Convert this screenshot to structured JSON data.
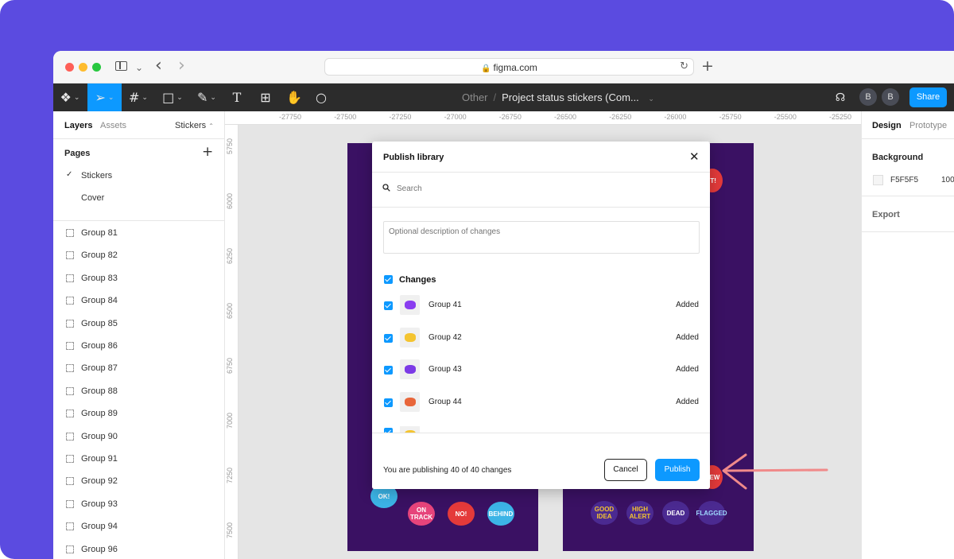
{
  "browser": {
    "url": "figma.com"
  },
  "toolbar": {
    "project": "Other",
    "file_name": "Project status stickers (Com...",
    "avatars": [
      "B",
      "B"
    ],
    "share_label": "Share"
  },
  "left_panel": {
    "tabs": [
      "Layers",
      "Assets"
    ],
    "page_selector": "Stickers",
    "pages_title": "Pages",
    "pages": [
      {
        "label": "Stickers",
        "selected": true
      },
      {
        "label": "Cover",
        "selected": false
      }
    ],
    "layers": [
      "Group 81",
      "Group 82",
      "Group 83",
      "Group 84",
      "Group 85",
      "Group 86",
      "Group 87",
      "Group 88",
      "Group 89",
      "Group 90",
      "Group 91",
      "Group 92",
      "Group 93",
      "Group 94",
      "Group 96"
    ]
  },
  "canvas": {
    "ruler_top": [
      "-27750",
      "-27500",
      "-27250",
      "-27000",
      "-26750",
      "-26500",
      "-26250",
      "-26000",
      "-25750",
      "-25500",
      "-25250"
    ],
    "ruler_left": [
      "5750",
      "6000",
      "6250",
      "6500",
      "6750",
      "7000",
      "7250",
      "7500"
    ],
    "frame_color": "#3a1163",
    "sticker_texts": [
      "OK!",
      "ON TRACK",
      "NO!",
      "BEHIND",
      "GOOD IDEA",
      "HIGH ALERT",
      "DEAD",
      "FLAGGED",
      "IT!",
      "NEW"
    ]
  },
  "modal": {
    "title": "Publish library",
    "search_placeholder": "Search",
    "description_placeholder": "Optional description of changes",
    "changes_label": "Changes",
    "items": [
      {
        "name": "Group 41",
        "status": "Added",
        "color": "#8a3df0"
      },
      {
        "name": "Group 42",
        "status": "Added",
        "color": "#f4c430"
      },
      {
        "name": "Group 43",
        "status": "Added",
        "color": "#7c3ae6"
      },
      {
        "name": "Group 44",
        "status": "Added",
        "color": "#e8663a"
      }
    ],
    "footer_text": "You are publishing 40 of 40 changes",
    "cancel_label": "Cancel",
    "publish_label": "Publish"
  },
  "right_panel": {
    "tabs": [
      "Design",
      "Prototype"
    ],
    "background_label": "Background",
    "background_hex": "F5F5F5",
    "background_opacity": "100",
    "export_label": "Export"
  },
  "colors": {
    "backdrop": "#5b4be0",
    "accent": "#0d99ff",
    "toolbar": "#2c2c2c",
    "annotation_arrow": "#f08a8a"
  }
}
